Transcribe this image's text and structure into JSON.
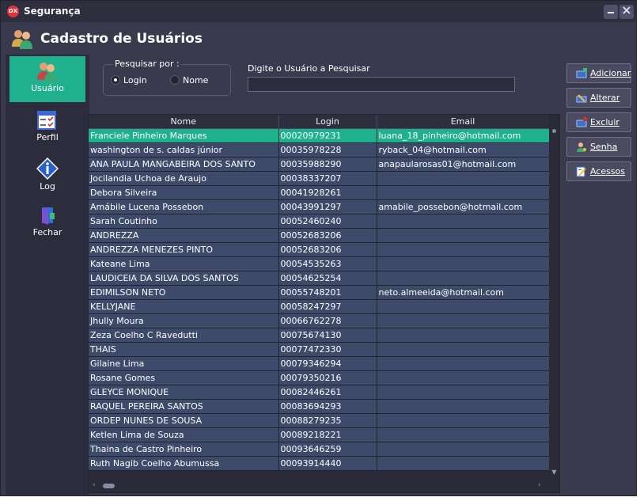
{
  "window": {
    "title": "Segurança",
    "icon": "dx-logo-icon"
  },
  "header": {
    "title": "Cadastro de Usuários",
    "icon": "users-icon"
  },
  "sidebar": {
    "items": [
      {
        "label": "Usuário",
        "icon": "user-icon",
        "active": true
      },
      {
        "label": "Perfil",
        "icon": "checklist-icon"
      },
      {
        "label": "Log",
        "icon": "info-icon"
      },
      {
        "label": "Fechar",
        "icon": "exit-door-icon"
      }
    ]
  },
  "search": {
    "group_label": "Pesquisar por :",
    "options": [
      {
        "label": "Login",
        "selected": true
      },
      {
        "label": "Nome",
        "selected": false
      }
    ],
    "input_label": "Digite o Usuário a Pesquisar",
    "value": ""
  },
  "actions": {
    "add": "Adicionar",
    "edit": "Alterar",
    "delete": "Excluir",
    "password": "Senha",
    "access": "Acessos"
  },
  "grid": {
    "columns": [
      "Nome",
      "Login",
      "Email"
    ],
    "rows": [
      [
        "Franciele Pinheiro Marques",
        "00020979231",
        "luana_18_pinheiro@hotmail.com"
      ],
      [
        "washington de s. caldas júnior",
        "00035978228",
        "ryback_04@hotmail.com"
      ],
      [
        "ANA PAULA MANGABEIRA DOS SANTO",
        "00035988290",
        "anapaularosas01@hotmail.com"
      ],
      [
        "Jocilandia Uchoa de Araujo",
        "00038337207",
        ""
      ],
      [
        "Debora Silveira",
        "00041928261",
        ""
      ],
      [
        "Amábile Lucena Possebon",
        "00043991297",
        "amabile_possebon@hotmail.com"
      ],
      [
        "Sarah Coutinho",
        "00052460240",
        ""
      ],
      [
        "ANDREZZA",
        "00052683206",
        ""
      ],
      [
        "ANDREZZA MENEZES PINTO",
        "00052683206",
        ""
      ],
      [
        "Kateane Lima",
        "00054535263",
        ""
      ],
      [
        "LAUDICEIA DA SILVA DOS SANTOS",
        "00054625254",
        ""
      ],
      [
        "EDIMILSON NETO",
        "00055748201",
        "neto.almeeida@hotmail.com"
      ],
      [
        "KELLYJANE",
        "00058247297",
        ""
      ],
      [
        "Jhully Moura",
        "00066762278",
        ""
      ],
      [
        "Zeza Coelho C Ravedutti",
        "00075674130",
        ""
      ],
      [
        "THAIS",
        "00077472330",
        ""
      ],
      [
        "Gilaine Lima",
        "00079346294",
        ""
      ],
      [
        "Rosane Gomes",
        "00079350216",
        ""
      ],
      [
        "GLEYCE MONIQUE",
        "00082446261",
        ""
      ],
      [
        "RAQUEL PEREIRA SANTOS",
        "00083694293",
        ""
      ],
      [
        "ORDEP NUNES DE SOUSA",
        "00088279235",
        ""
      ],
      [
        "Ketlen Lima de Souza",
        "00089218221",
        ""
      ],
      [
        "Thaina de Castro Pinheiro",
        "00093646259",
        ""
      ],
      [
        "Ruth Nagib Coelho Abumussa",
        "00093914440",
        ""
      ]
    ],
    "selected_row": 0
  },
  "colors": {
    "accent": "#1fb08e",
    "row": "#3e4a6a",
    "panel": "#3a3a4e",
    "title_icon": "#e0333a"
  }
}
